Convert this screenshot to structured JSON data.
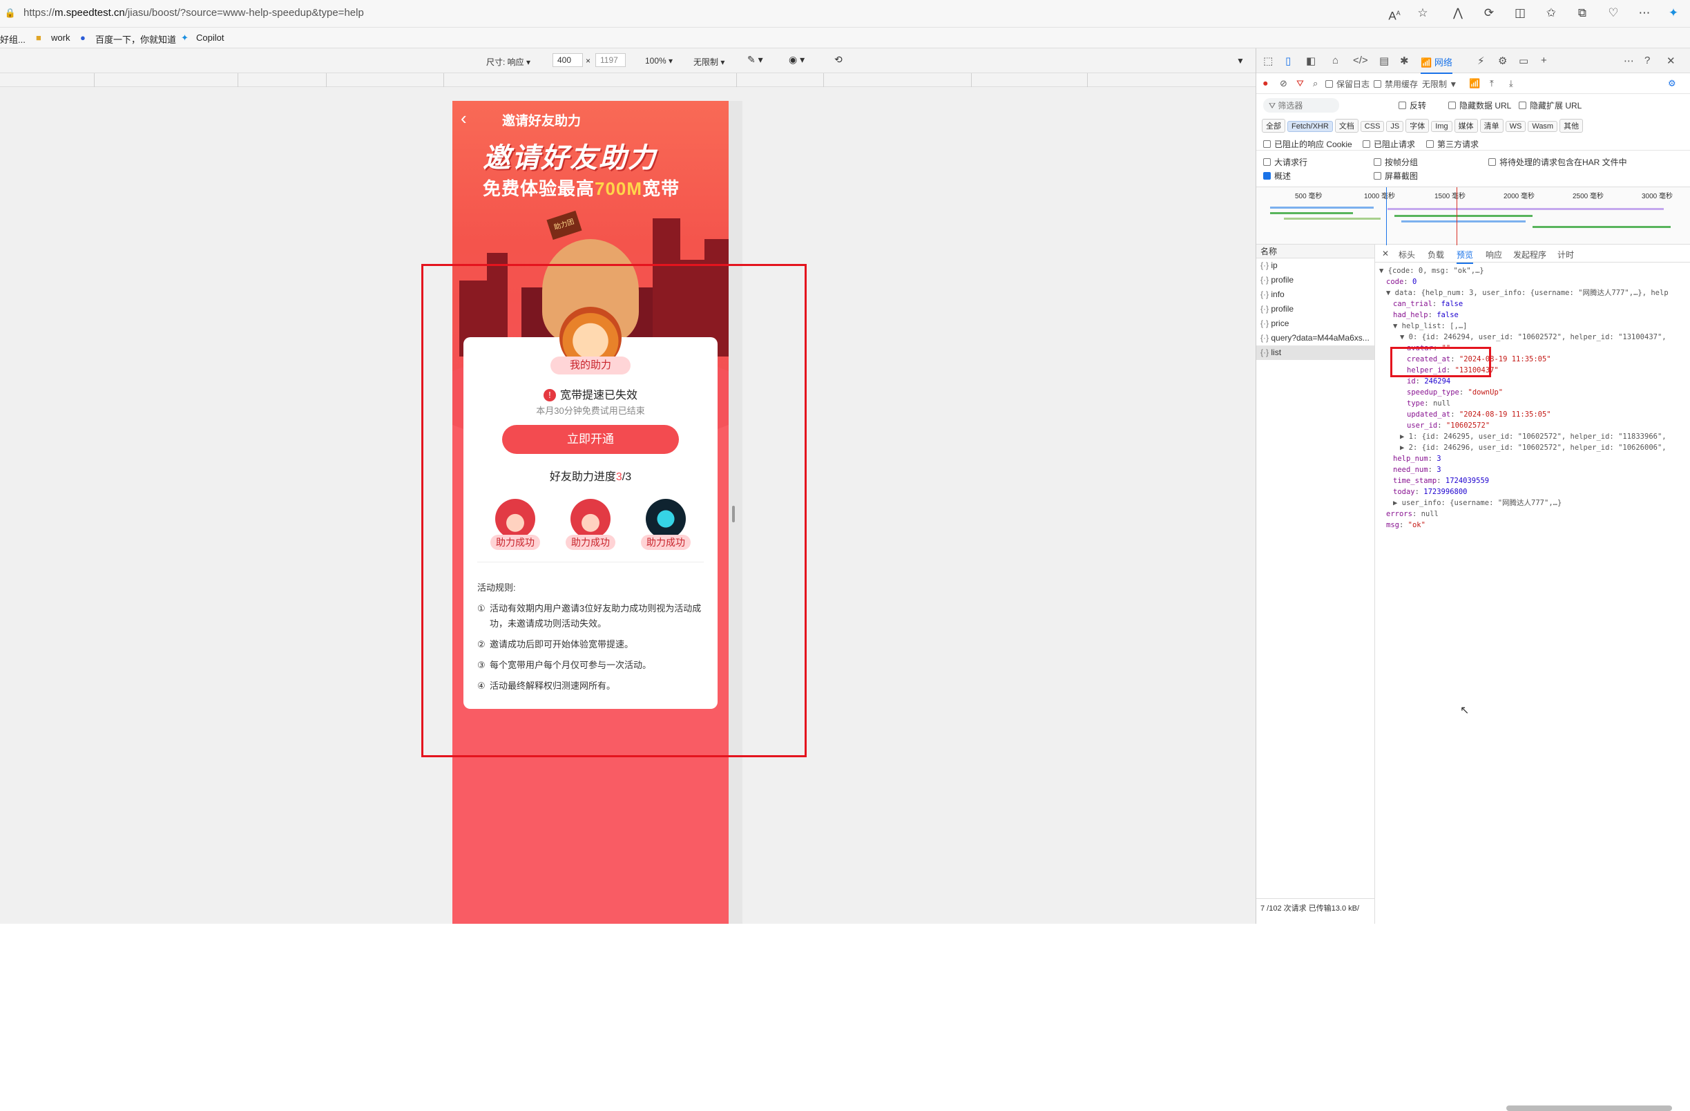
{
  "browser": {
    "url_prefix": "https://",
    "url_host": "m.speedtest.cn",
    "url_path": "/jiasu/boost/?source=www-help-speedup&type=help",
    "bookmarks": [
      "好组...",
      "work",
      "百度一下，你就知道",
      "Copilot"
    ]
  },
  "device_toolbar": {
    "dimensions_label": "尺寸: 响应",
    "width": "400",
    "times": "×",
    "height": "1197",
    "zoom": "100%",
    "throttle": "无限制"
  },
  "page": {
    "nav_title": "邀请好友助力",
    "back_icon": "chevron-left-icon",
    "headline": "邀请好友助力",
    "subheadline_pre": "免费体验最高",
    "subheadline_highlight": "700M",
    "subheadline_post": "宽带",
    "badge_my_help": "我的助力",
    "status_title": "宽带提速已失效",
    "status_sub": "本月30分钟免费试用已结束",
    "open_button": "立即开通",
    "progress_pre": "好友助力进度",
    "progress_done": "3",
    "progress_total": "/3",
    "helpers": [
      "助力成功",
      "助力成功",
      "助力成功"
    ],
    "rules_title": "活动规则:",
    "rules": [
      {
        "n": "①",
        "t": "活动有效期内用户邀请3位好友助力成功则视为活动成功，未邀请成功则活动失效。"
      },
      {
        "n": "②",
        "t": "邀请成功后即可开始体验宽带提速。"
      },
      {
        "n": "③",
        "t": "每个宽带用户每个月仅可参与一次活动。"
      },
      {
        "n": "④",
        "t": "活动最终解释权归测速网所有。"
      }
    ]
  },
  "devtools": {
    "network_tab": "网络",
    "preserve_log": "保留日志",
    "disable_cache": "禁用缓存",
    "throttle": "无限制",
    "filter_placeholder": "筛选器",
    "invert": "反转",
    "hide_data_url": "隐藏数据 URL",
    "hide_ext_url": "隐藏扩展 URL",
    "type_chips": [
      "全部",
      "Fetch/XHR",
      "文档",
      "CSS",
      "JS",
      "字体",
      "Img",
      "媒体",
      "清单",
      "WS",
      "Wasm",
      "其他"
    ],
    "blocked_cookies": "已阻止的响应 Cookie",
    "blocked_requests": "已阻止请求",
    "third_party": "第三方请求",
    "big_rows": "大请求行",
    "group_by_frame": "按帧分组",
    "har_option": "将待处理的请求包含在HAR 文件中",
    "overview": "概述",
    "screenshots": "屏幕截图",
    "timeline_ticks": [
      "500 毫秒",
      "1000 毫秒",
      "1500 毫秒",
      "2000 毫秒",
      "2500 毫秒",
      "3000 毫秒"
    ],
    "name_header": "名称",
    "requests": [
      "ip",
      "profile",
      "info",
      "profile",
      "price",
      "query?data=M44aMa6xs...",
      "list"
    ],
    "selected_request": "list",
    "status": "7 /102 次请求  已传输13.0 kB/",
    "preview_tabs": [
      "标头",
      "负载",
      "预览",
      "响应",
      "发起程序",
      "计时"
    ],
    "selected_preview_tab": "预览",
    "json_lines": [
      {
        "i": 0,
        "t": "▼ {code: 0, msg: \"ok\",…}",
        "c": "g"
      },
      {
        "i": 1,
        "k": "code",
        "v": "0",
        "vc": "num"
      },
      {
        "i": 1,
        "t": "▼ data: {help_num: 3, user_info: {username: \"网腾达人777\",…}, help",
        "c": "g"
      },
      {
        "i": 2,
        "k": "can_trial",
        "v": "false",
        "vc": "num"
      },
      {
        "i": 2,
        "k": "had_help",
        "v": "false",
        "vc": "num"
      },
      {
        "i": 2,
        "t": "▼ help_list: [,…]",
        "c": "g"
      },
      {
        "i": 3,
        "t": "▼ 0: {id: 246294, user_id: \"10602572\", helper_id: \"13100437\",",
        "c": "g"
      },
      {
        "i": 4,
        "k": "avatar",
        "v": "\"\"",
        "vc": "s"
      },
      {
        "i": 4,
        "k": "created_at",
        "v": "\"2024-08-19 11:35:05\"",
        "vc": "s"
      },
      {
        "i": 4,
        "k": "helper_id",
        "v": "\"13100437\"",
        "vc": "s"
      },
      {
        "i": 4,
        "k": "id",
        "v": "246294",
        "vc": "num"
      },
      {
        "i": 4,
        "k": "speedup_type",
        "v": "\"downUp\"",
        "vc": "s"
      },
      {
        "i": 4,
        "k": "type",
        "v": "null",
        "vc": "g"
      },
      {
        "i": 4,
        "k": "updated_at",
        "v": "\"2024-08-19 11:35:05\"",
        "vc": "s"
      },
      {
        "i": 4,
        "k": "user_id",
        "v": "\"10602572\"",
        "vc": "s"
      },
      {
        "i": 3,
        "t": "▶ 1: {id: 246295, user_id: \"10602572\", helper_id: \"11833966\",",
        "c": "g"
      },
      {
        "i": 3,
        "t": "▶ 2: {id: 246296, user_id: \"10602572\", helper_id: \"10626006\",",
        "c": "g"
      },
      {
        "i": 2,
        "k": "help_num",
        "v": "3",
        "vc": "num"
      },
      {
        "i": 2,
        "k": "need_num",
        "v": "3",
        "vc": "num"
      },
      {
        "i": 2,
        "k": "time_stamp",
        "v": "1724039559",
        "vc": "num"
      },
      {
        "i": 2,
        "k": "today",
        "v": "1723996800",
        "vc": "num"
      },
      {
        "i": 2,
        "t": "▶ user_info: {username: \"网腾达人777\",…}",
        "c": "g"
      },
      {
        "i": 1,
        "k": "errors",
        "v": "null",
        "vc": "g"
      },
      {
        "i": 1,
        "k": "msg",
        "v": "\"ok\"",
        "vc": "s"
      }
    ]
  },
  "colors": {
    "accent": "#f34b50",
    "highlight_box": "#e4141e",
    "devtools_blue": "#1a73e8"
  }
}
